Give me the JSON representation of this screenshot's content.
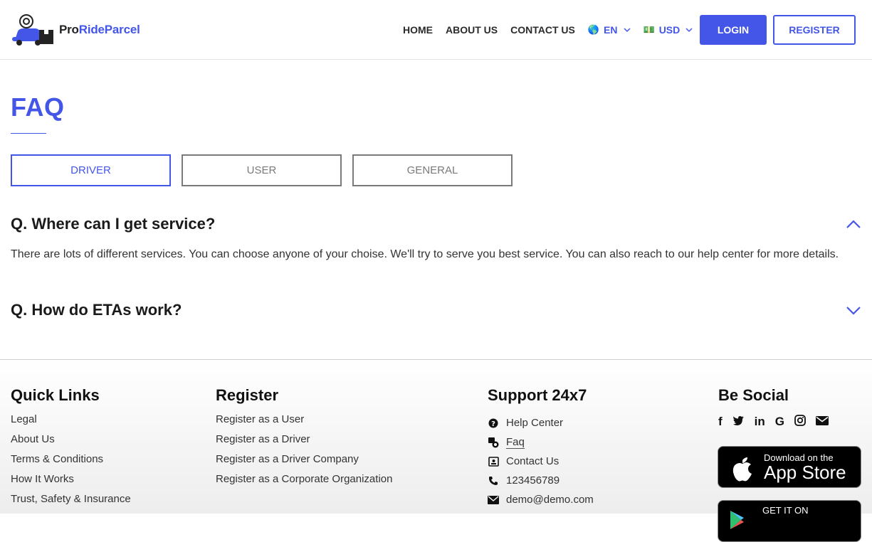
{
  "brand": {
    "part1": "Pro",
    "part2": "RideParcel"
  },
  "nav": {
    "home": "HOME",
    "about": "ABOUT US",
    "contact": "CONTACT US",
    "lang": {
      "icon": "globe-icon",
      "glyph": "🌎",
      "label": "EN"
    },
    "currency": {
      "icon": "banknote-icon",
      "glyph": "💵",
      "label": "USD"
    },
    "login": "LOGIN",
    "register": "REGISTER"
  },
  "page": {
    "title": "FAQ"
  },
  "tabs": [
    {
      "label": "DRIVER",
      "active": true
    },
    {
      "label": "USER",
      "active": false
    },
    {
      "label": "GENERAL",
      "active": false
    }
  ],
  "faq": [
    {
      "question": "Q.  Where can I get service?",
      "answer": "There are lots of different services. You can choose anyone of your choise. We'll try to serve you best service. You can also reach to our help center for more details.",
      "expanded": true
    },
    {
      "question": "Q.  How do ETAs work?",
      "expanded": false
    }
  ],
  "footer": {
    "quick_links": {
      "title": "Quick Links",
      "items": [
        "Legal",
        "About Us",
        "Terms & Conditions",
        "How It Works",
        "Trust, Safety & Insurance"
      ]
    },
    "register": {
      "title": "Register",
      "items": [
        "Register as a User",
        "Register as a Driver",
        "Register as a Driver Company",
        "Register as a Corporate Organization"
      ]
    },
    "support": {
      "title": "Support 24x7",
      "items": [
        {
          "icon": "question-circle-icon",
          "label": "Help Center"
        },
        {
          "icon": "faq-icon",
          "label": "Faq"
        },
        {
          "icon": "contact-card-icon",
          "label": "Contact Us"
        },
        {
          "icon": "phone-icon",
          "label": "123456789"
        },
        {
          "icon": "envelope-icon",
          "label": "demo@demo.com"
        }
      ]
    },
    "social": {
      "title": "Be Social",
      "icons": [
        {
          "name": "facebook-icon",
          "glyph": "f"
        },
        {
          "name": "twitter-icon",
          "glyph": "🐦"
        },
        {
          "name": "linkedin-icon",
          "glyph": "in"
        },
        {
          "name": "google-icon",
          "glyph": "G"
        },
        {
          "name": "instagram-icon",
          "glyph": "◎"
        },
        {
          "name": "envelope-icon",
          "glyph": "✉"
        }
      ]
    },
    "app_store": {
      "top": "Download on the",
      "big": "App Store"
    },
    "play_store": {
      "top": "GET IT ON"
    }
  },
  "colors": {
    "accent": "#4356e8",
    "text": "#222222",
    "tab_inactive": "#7a7a7a"
  }
}
